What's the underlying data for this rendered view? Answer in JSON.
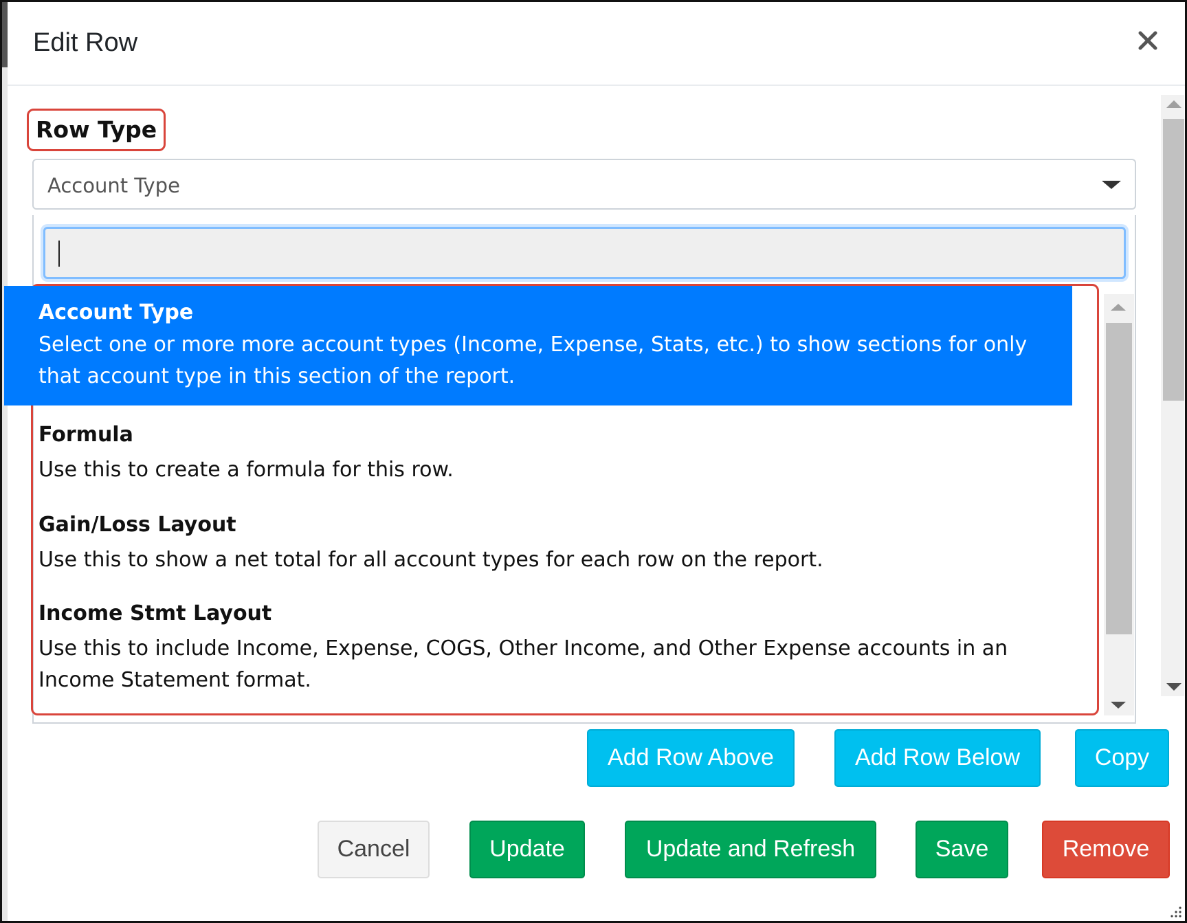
{
  "modal": {
    "title": "Edit Row",
    "close_icon": "close-icon"
  },
  "form": {
    "row_type_label": "Row Type",
    "select": {
      "selected_value": "Account Type",
      "caret_icon": "chevron-down-icon"
    },
    "search": {
      "value": "",
      "placeholder": ""
    },
    "options": [
      {
        "title": "Account Type",
        "description": "Select one or more more account types (Income, Expense, Stats, etc.) to show sections for only that account type in this section of the report.",
        "selected": true
      },
      {
        "title": "Formula",
        "description": "Use this to create a formula for this row.",
        "selected": false
      },
      {
        "title": "Gain/Loss Layout",
        "description": "Use this to show a net total for all account types for each row on the report.",
        "selected": false
      },
      {
        "title": "Income Stmt Layout",
        "description": "Use this to include Income, Expense, COGS, Other Income, and Other Expense accounts in an Income Statement format.",
        "selected": false
      }
    ]
  },
  "row_actions": {
    "add_above": "Add Row Above",
    "add_below": "Add Row Below",
    "copy": "Copy"
  },
  "footer": {
    "cancel": "Cancel",
    "update": "Update",
    "update_refresh": "Update and Refresh",
    "save": "Save",
    "remove": "Remove"
  },
  "colors": {
    "selected_option": "#007bff",
    "highlight_outline": "#d9453b",
    "info_button": "#00c0ef",
    "success_button": "#00a65a",
    "danger_button": "#dd4b39"
  }
}
